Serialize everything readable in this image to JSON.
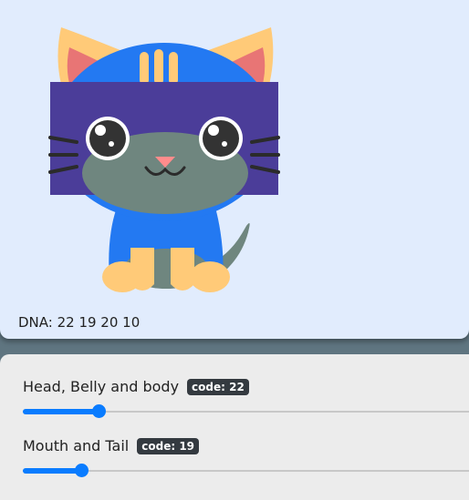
{
  "dna": {
    "label": "DNA: 22 19 20 10"
  },
  "controls": [
    {
      "label": "Head, Belly and body",
      "code": "code: 22",
      "value_fraction": 0.17
    },
    {
      "label": "Mouth and Tail",
      "code": "code: 19",
      "value_fraction": 0.13
    }
  ],
  "colors": {
    "head_body": "#2379f2",
    "mouth_tail": "#6f867f",
    "eyes_band": "#4b3d99",
    "ears_paws": "#ffca78",
    "ear_inner": "#e87575",
    "nose": "#ff8c8c",
    "slider_accent": "#0a7cff"
  }
}
